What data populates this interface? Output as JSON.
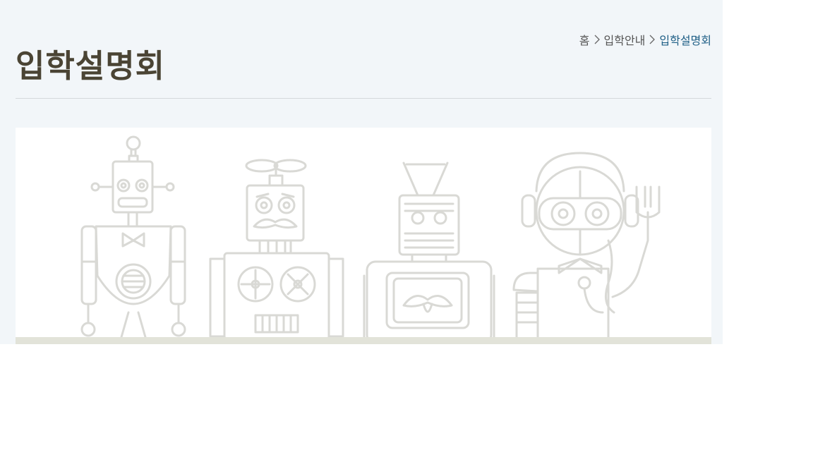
{
  "breadcrumb": {
    "home": "홈",
    "parent": "입학안내",
    "current": "입학설명회"
  },
  "page": {
    "title": "입학설명회"
  },
  "colors": {
    "background": "#f2f6f9",
    "title": "#4a4434",
    "breadcrumb_current": "#1f5f86",
    "robot_line": "#d9d9d5",
    "ground": "#e2e3d9"
  },
  "banner": {
    "icons": [
      "robot-icon",
      "robot-icon",
      "robot-icon",
      "robot-icon"
    ]
  }
}
